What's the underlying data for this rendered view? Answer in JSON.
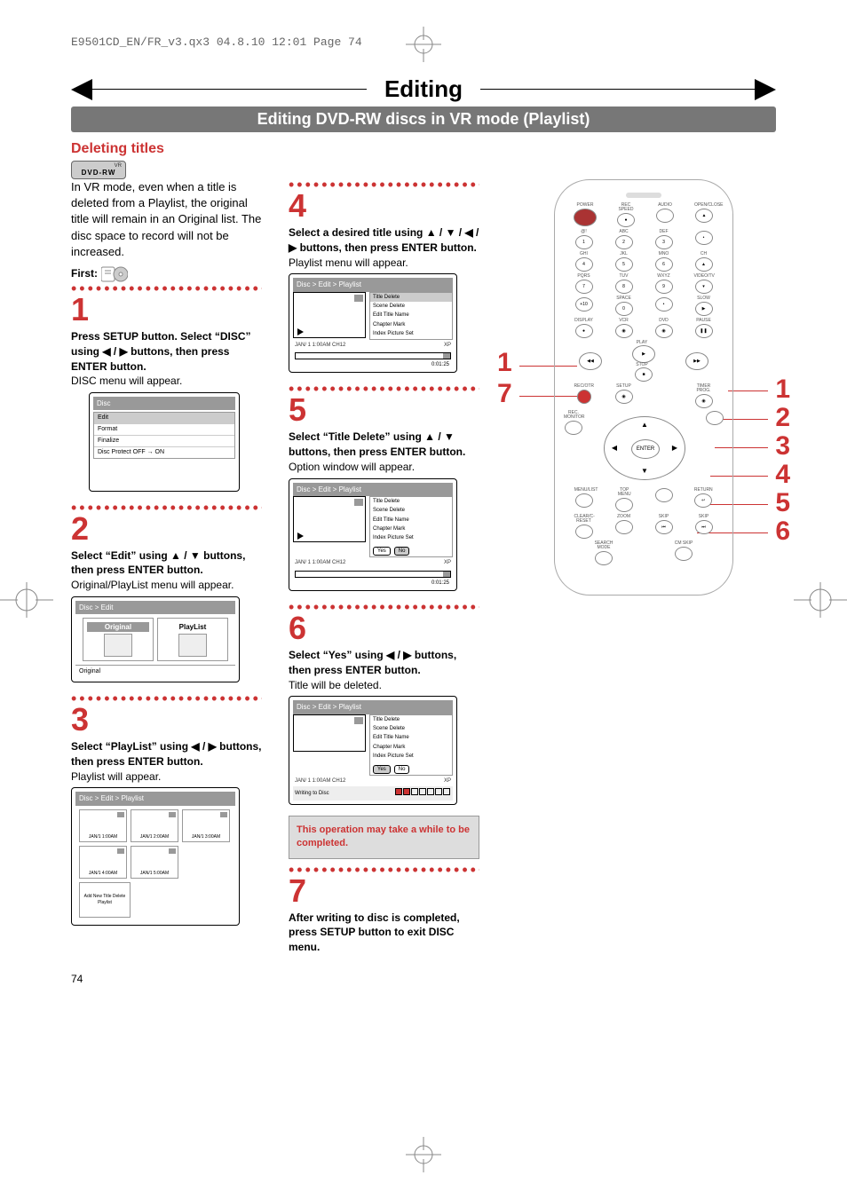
{
  "header_line": "E9501CD_EN/FR_v3.qx3  04.8.10  12:01  Page 74",
  "page_number": "74",
  "main_title": "Editing",
  "sub_title": "Editing DVD-RW discs in VR mode (Playlist)",
  "section_title": "Deleting titles",
  "badge": {
    "top": "VR",
    "main": "DVD-RW"
  },
  "intro": "In VR mode, even when a title is deleted from a Playlist, the original title will remain in an Original list. The disc space to record will not be increased.",
  "first_label": "First:",
  "disc_icon_alt": "DVD disc icon",
  "steps": {
    "1": {
      "num": "1",
      "bold": "Press SETUP button. Select “DISC” using ◀ / ▶ buttons, then press ENTER button.",
      "desc": "DISC menu will appear."
    },
    "2": {
      "num": "2",
      "bold": "Select “Edit” using ▲ / ▼ buttons, then press ENTER button.",
      "desc": "Original/PlayList menu will appear."
    },
    "3": {
      "num": "3",
      "bold": "Select “PlayList” using ◀ / ▶ buttons, then press ENTER button.",
      "desc": "Playlist will appear."
    },
    "4": {
      "num": "4",
      "bold": "Select a desired title using ▲ / ▼ / ◀ / ▶ buttons, then press ENTER button.",
      "desc": "Playlist menu will appear."
    },
    "5": {
      "num": "5",
      "bold": "Select “Title Delete” using ▲ / ▼ buttons, then press ENTER button.",
      "desc": "Option window will appear."
    },
    "6": {
      "num": "6",
      "bold": "Select “Yes” using ◀ / ▶ buttons, then press ENTER button.",
      "desc": "Title will be deleted."
    },
    "7": {
      "num": "7",
      "bold": "After writing to disc is completed, press SETUP button to exit DISC menu."
    }
  },
  "note": "This operation may take a while to be completed.",
  "screens": {
    "disc_menu": {
      "header": "Disc",
      "items": [
        "Edit",
        "Format",
        "Finalize",
        "Disc Protect OFF → ON"
      ]
    },
    "edit_menu": {
      "header": "Disc > Edit",
      "tabs": {
        "original": "Original",
        "playlist": "PlayList"
      },
      "footer": "Original"
    },
    "playlist_grid": {
      "header": "Disc > Edit > Playlist",
      "thumbs": [
        "JAN/1  1:00AM",
        "JAN/1  2:00AM",
        "JAN/1  3:00AM",
        "JAN/1  4:00AM",
        "JAN/1  5:00AM"
      ],
      "add_new": "Add New Title Delete Playlist"
    },
    "title_menu": {
      "header": "Disc > Edit > Playlist",
      "items": [
        "Title Delete",
        "Scene Delete",
        "Edit Title Name",
        "Chapter Mark",
        "Index Picture Set"
      ],
      "footer_left": "JAN/ 1   1:00AM  CH12",
      "footer_mid": "XP",
      "footer_right": "0:01:25"
    },
    "confirm": {
      "header": "Disc > Edit > Playlist",
      "items": [
        "Title Delete",
        "Scene Delete",
        "Edit Title Name",
        "Chapter Mark",
        "Index Picture Set"
      ],
      "yes": "Yes",
      "no": "No",
      "footer_left": "JAN/ 1   1:00AM  CH12",
      "footer_mid": "XP",
      "footer_right": "0:01:25"
    },
    "writing": {
      "header": "Disc > Edit > Playlist",
      "items": [
        "Title Delete",
        "Scene Delete",
        "Edit Title Name",
        "Chapter Mark",
        "Index Picture Set"
      ],
      "yes": "Yes",
      "no": "No",
      "footer_left": "JAN/ 1   1:00AM  CH12",
      "footer_mid": "XP",
      "writing_label": "Writing to Disc"
    }
  },
  "remote": {
    "top_row": [
      "POWER",
      "REC SPEED",
      "AUDIO",
      "OPEN/CLOSE"
    ],
    "num_row1": [
      {
        "l": "@!",
        "n": "1"
      },
      {
        "l": "ABC",
        "n": "2"
      },
      {
        "l": "DEF",
        "n": "3"
      },
      {
        "l": "",
        "n": "•"
      }
    ],
    "num_row2": [
      {
        "l": "GHI",
        "n": "4"
      },
      {
        "l": "JKL",
        "n": "5"
      },
      {
        "l": "MNO",
        "n": "6"
      },
      {
        "l": "CH",
        "n": "▲"
      }
    ],
    "num_row3": [
      {
        "l": "PQRS",
        "n": "7"
      },
      {
        "l": "TUV",
        "n": "8"
      },
      {
        "l": "WXYZ",
        "n": "9"
      },
      {
        "l": "VIDEO/TV",
        "n": "▾"
      }
    ],
    "num_row4": [
      {
        "l": "",
        "n": "+10"
      },
      {
        "l": "SPACE",
        "n": "0"
      },
      {
        "l": "",
        "n": "•"
      },
      {
        "l": "SLOW",
        "n": "▶"
      }
    ],
    "misc_row": [
      "DISPLAY",
      "VCR",
      "DVD",
      "PAUSE"
    ],
    "transport": {
      "rew": "◀◀",
      "play": "PLAY",
      "fwd": "▶▶",
      "stop": "STOP"
    },
    "setup_row": [
      "REC/OTR",
      "SETUP",
      "",
      "TIMER PROG."
    ],
    "mid_row": [
      "REC. MONITOR",
      "",
      "ENTER",
      ""
    ],
    "menu_row": [
      "MENU/LIST",
      "TOP MENU",
      "",
      "RETURN"
    ],
    "bottom_row1": [
      "CLEAR/C-RESET",
      "ZOOM",
      "SKIP",
      "SKIP"
    ],
    "bottom_row2": [
      "SEARCH MODE",
      "CM SKIP",
      "",
      ""
    ]
  },
  "callouts": {
    "left": [
      "1",
      "7"
    ],
    "right": [
      "1",
      "2",
      "3",
      "4",
      "5",
      "6"
    ]
  }
}
